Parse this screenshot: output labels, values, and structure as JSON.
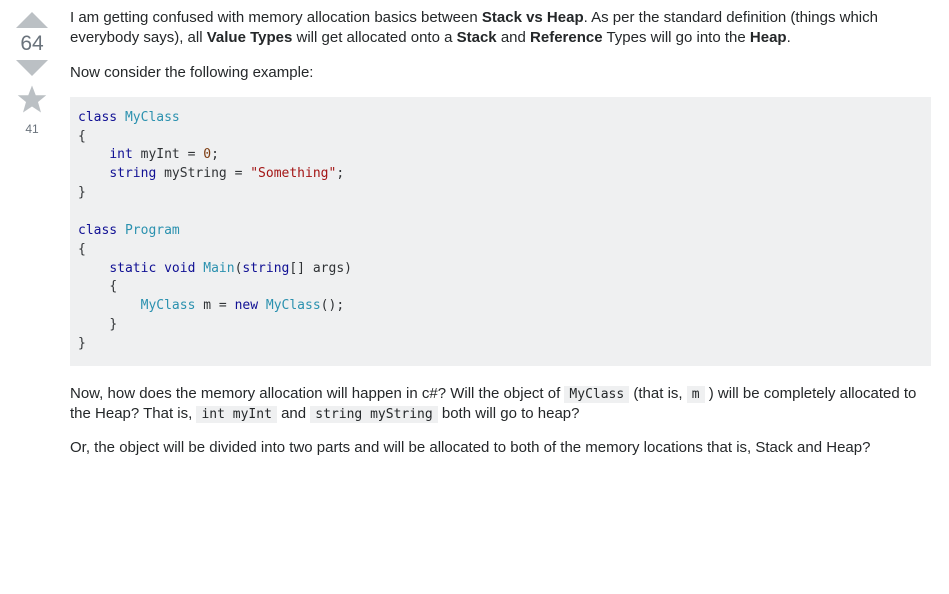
{
  "vote": {
    "score": "64",
    "favorites": "41"
  },
  "question": {
    "p1_a": "I am getting confused with memory allocation basics between ",
    "p1_b1": "Stack vs Heap",
    "p1_c": ". As per the standard definition (things which everybody says), all ",
    "p1_b2": "Value Types",
    "p1_d": " will get allocated onto a ",
    "p1_b3": "Stack",
    "p1_e": " and ",
    "p1_b4": "Reference",
    "p1_f": " Types will go into the ",
    "p1_b5": "Heap",
    "p1_g": ".",
    "p2": "Now consider the following example:",
    "p3_a": "Now, how does the memory allocation will happen in c#? Will the object of ",
    "p3_code1": "MyClass",
    "p3_b": " (that is, ",
    "p3_code2": "m",
    "p3_c": " ) will be completely allocated to the Heap? That is, ",
    "p3_code3": "int myInt",
    "p3_d": " and ",
    "p3_code4": "string myString",
    "p3_e": " both will go to heap?",
    "p4": "Or, the object will be divided into two parts and will be allocated to both of the memory locations that is, Stack and Heap?"
  },
  "code": {
    "kw_class1": "class",
    "typ_myclass1": "MyClass",
    "brace_o1": "{",
    "kw_int": "int",
    "pln_myint": " myInt ",
    "pun_eq1": "=",
    "num_zero": "0",
    "pun_semi1": ";",
    "kw_string": "string",
    "pln_mystr": " myString ",
    "pun_eq2": "=",
    "str_something": "\"Something\"",
    "pun_semi2": ";",
    "brace_c1": "}",
    "kw_class2": "class",
    "typ_program": "Program",
    "brace_o2": "{",
    "kw_static": "static",
    "kw_void": "void",
    "typ_main": "Main",
    "pun_paren_o": "(",
    "kw_stringarr": "string",
    "pun_brackets": "[]",
    "pln_args": " args",
    "pun_paren_c": ")",
    "brace_o3": "{",
    "typ_myclass2": "MyClass",
    "pln_m": " m ",
    "pun_eq3": "=",
    "kw_new": "new",
    "typ_myclass3": "MyClass",
    "pun_ctor": "();",
    "brace_c3": "}",
    "brace_c2": "}"
  },
  "icons": {
    "upvote": "upvote-arrow",
    "downvote": "downvote-arrow",
    "star": "favorite-star"
  },
  "colors": {
    "arrow_gray": "#bbc0c4",
    "star_gray": "#bbc0c4",
    "code_bg": "#eff0f1"
  }
}
